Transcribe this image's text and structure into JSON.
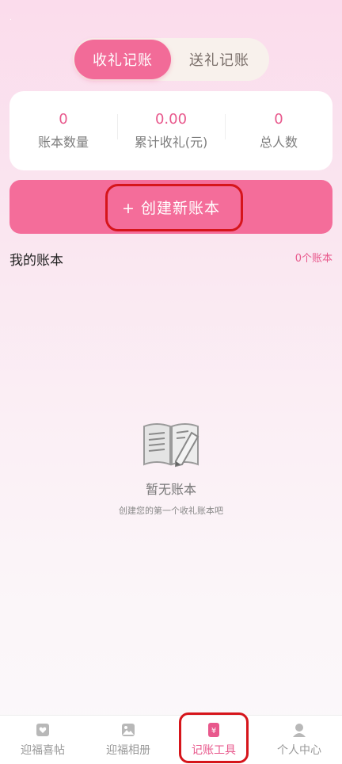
{
  "tabs": [
    {
      "label": "收礼记账",
      "active": true
    },
    {
      "label": "送礼记账",
      "active": false
    }
  ],
  "stats": [
    {
      "value": "0",
      "label": "账本数量"
    },
    {
      "value": "0.00",
      "label": "累计收礼(元)"
    },
    {
      "value": "0",
      "label": "总人数"
    }
  ],
  "create_button": {
    "label": "+ 创建新账本"
  },
  "section": {
    "title": "我的账本",
    "count": "0个账本"
  },
  "empty": {
    "title": "暂无账本",
    "subtitle": "创建您的第一个收礼账本吧",
    "icon": "open-book-pencil-icon"
  },
  "nav": [
    {
      "label": "迎福喜帖",
      "icon": "invitation-icon",
      "active": false
    },
    {
      "label": "迎福相册",
      "icon": "photo-album-icon",
      "active": false
    },
    {
      "label": "记账工具",
      "icon": "yuan-ledger-icon",
      "active": true
    },
    {
      "label": "个人中心",
      "icon": "user-icon",
      "active": false
    }
  ],
  "colors": {
    "accent": "#f46d9a",
    "accent_text": "#e8588c",
    "highlight": "#d6151b"
  }
}
